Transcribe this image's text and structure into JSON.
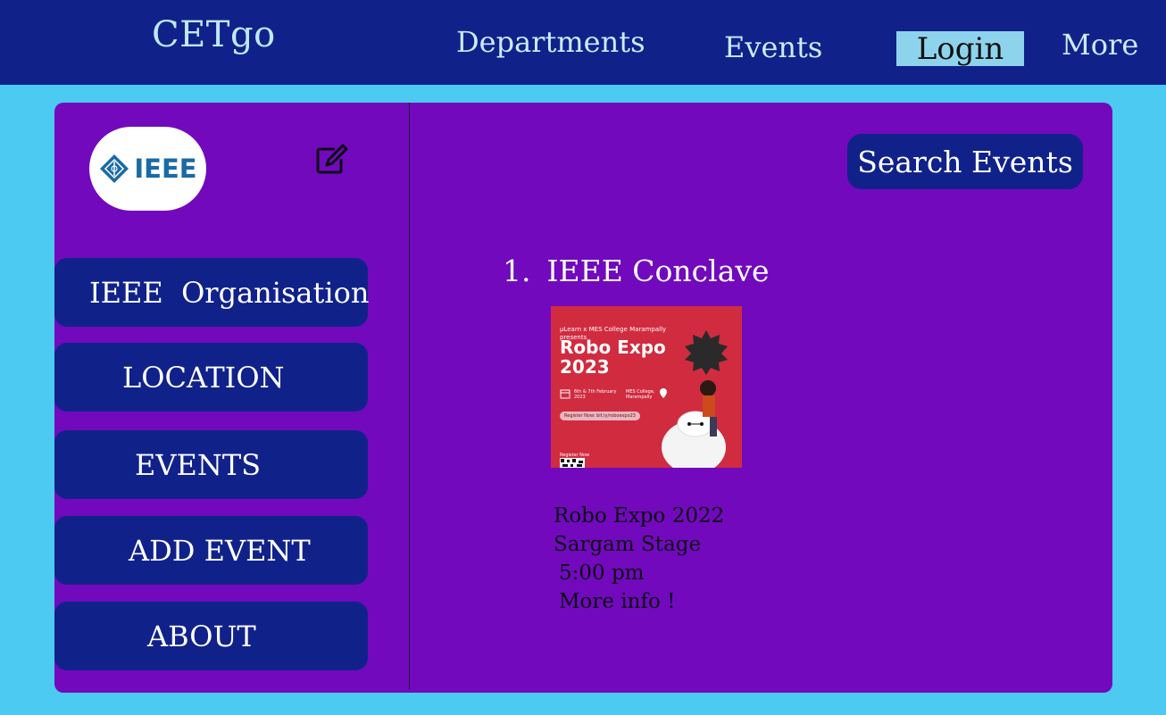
{
  "header": {
    "brand": "CETgo",
    "nav": {
      "departments": "Departments",
      "events": "Events",
      "login": "Login",
      "more": "More"
    }
  },
  "sidebar": {
    "logo_text": "IEEE",
    "edit_icon": "edit-icon",
    "items": [
      {
        "label": "IEEE  Organisation"
      },
      {
        "label": "LOCATION"
      },
      {
        "label": "EVENTS"
      },
      {
        "label": "ADD EVENT"
      },
      {
        "label": "ABOUT"
      }
    ]
  },
  "main": {
    "search_label": "Search Events",
    "events": [
      {
        "number": "1.",
        "title": "IEEE Conclave",
        "poster": {
          "presenter": "µLearn x MES College Marampally",
          "presents": "presents",
          "headline": "Robo Expo 2023",
          "dates": "6th & 7th February 2023",
          "venue": "MES College, Marampally",
          "register": "Register Now: bit.ly/roboexpo23",
          "register_now": "Register Now"
        },
        "name": "Robo Expo 2022",
        "venue": "Sargam Stage",
        "time": "5:00 pm",
        "more_info": "More info !"
      }
    ]
  },
  "colors": {
    "page_bg": "#4ccaf1",
    "header_bg": "#10228a",
    "panel_bg": "#7209bd",
    "button_bg": "#10228a",
    "login_bg": "#8ed3ec",
    "poster_bg": "#d12b3f"
  }
}
